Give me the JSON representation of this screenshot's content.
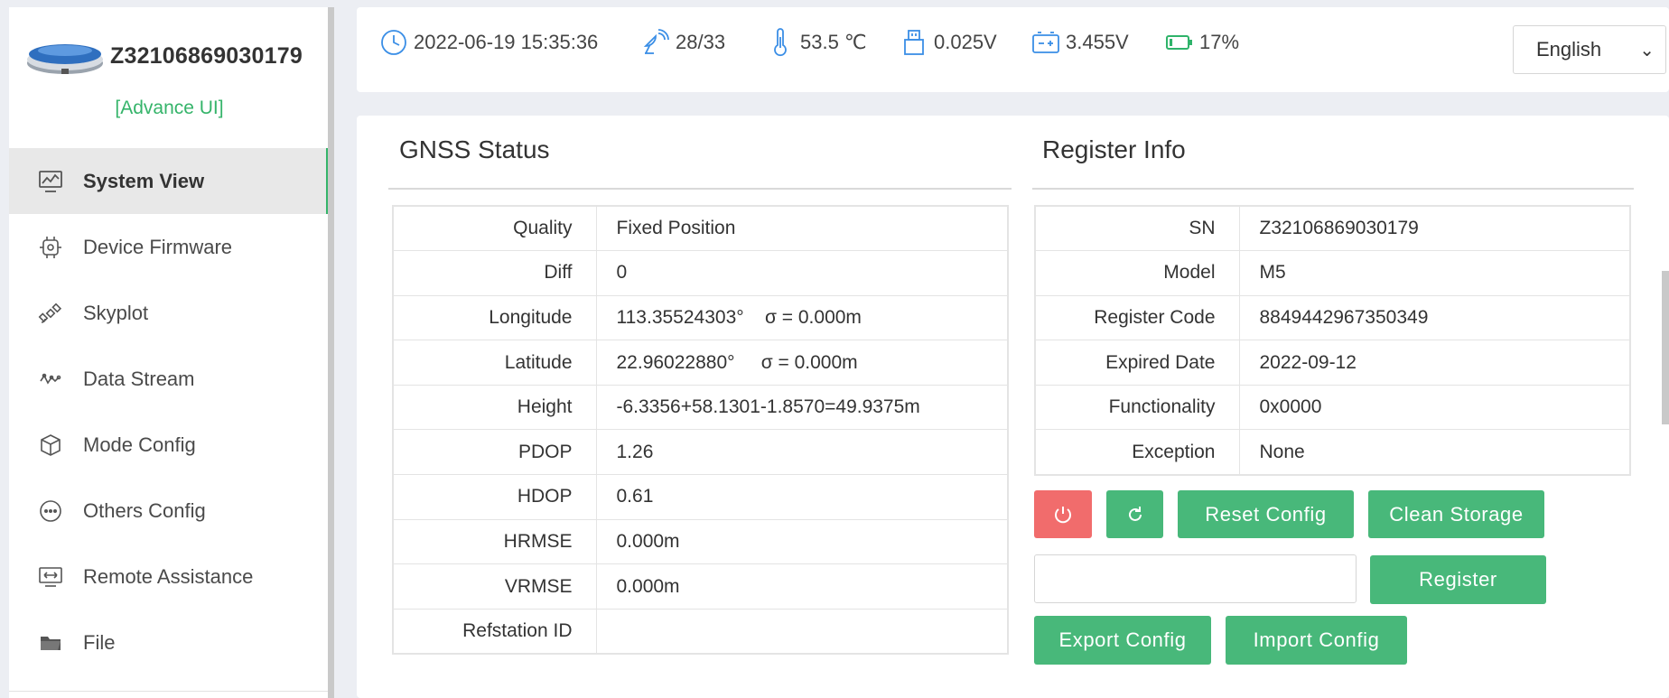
{
  "sidebar": {
    "device_title": "Z32106869030179",
    "advance_link": "[Advance UI]",
    "items": [
      {
        "label": "System View",
        "icon": "chart-monitor-icon"
      },
      {
        "label": "Device Firmware",
        "icon": "chip-icon"
      },
      {
        "label": "Skyplot",
        "icon": "satellite-icon"
      },
      {
        "label": "Data Stream",
        "icon": "wave-icon"
      },
      {
        "label": "Mode Config",
        "icon": "cube-icon"
      },
      {
        "label": "Others Config",
        "icon": "more-dots-icon"
      },
      {
        "label": "Remote Assistance",
        "icon": "remote-screen-icon"
      },
      {
        "label": "File",
        "icon": "folder-icon"
      }
    ]
  },
  "header": {
    "datetime": "2022-06-19 15:35:36",
    "satellites": "28/33",
    "temperature": "53.5 ℃",
    "external_voltage": "0.025V",
    "battery_voltage": "3.455V",
    "battery_percent": "17%",
    "language": "English",
    "battery_level": 0.17
  },
  "gnss": {
    "title": "GNSS Status",
    "rows": [
      {
        "key": "Quality",
        "value": "Fixed Position"
      },
      {
        "key": "Diff",
        "value": "0"
      },
      {
        "key": "Longitude",
        "value": "113.35524303°    σ = 0.000m"
      },
      {
        "key": "Latitude",
        "value": "22.96022880°     σ = 0.000m"
      },
      {
        "key": "Height",
        "value": "-6.3356+58.1301-1.8570=49.9375m"
      },
      {
        "key": "PDOP",
        "value": "1.26"
      },
      {
        "key": "HDOP",
        "value": "0.61"
      },
      {
        "key": "HRMSE",
        "value": "0.000m"
      },
      {
        "key": "VRMSE",
        "value": "0.000m"
      },
      {
        "key": "Refstation ID",
        "value": ""
      }
    ]
  },
  "register": {
    "title": "Register Info",
    "rows": [
      {
        "key": "SN",
        "value": "Z32106869030179"
      },
      {
        "key": "Model",
        "value": "M5"
      },
      {
        "key": "Register Code",
        "value": "8849442967350349"
      },
      {
        "key": "Expired Date",
        "value": "2022-09-12"
      },
      {
        "key": "Functionality",
        "value": "0x0000"
      },
      {
        "key": "Exception",
        "value": "None"
      }
    ],
    "reset_config": "Reset Config",
    "clean_storage": "Clean Storage",
    "register_button": "Register",
    "register_input_value": "",
    "export_config": "Export Config",
    "import_config": "Import Config"
  },
  "colors": {
    "accent_green": "#48b87a",
    "danger_red": "#f16c6c",
    "icon_blue": "#3a8ee6"
  }
}
